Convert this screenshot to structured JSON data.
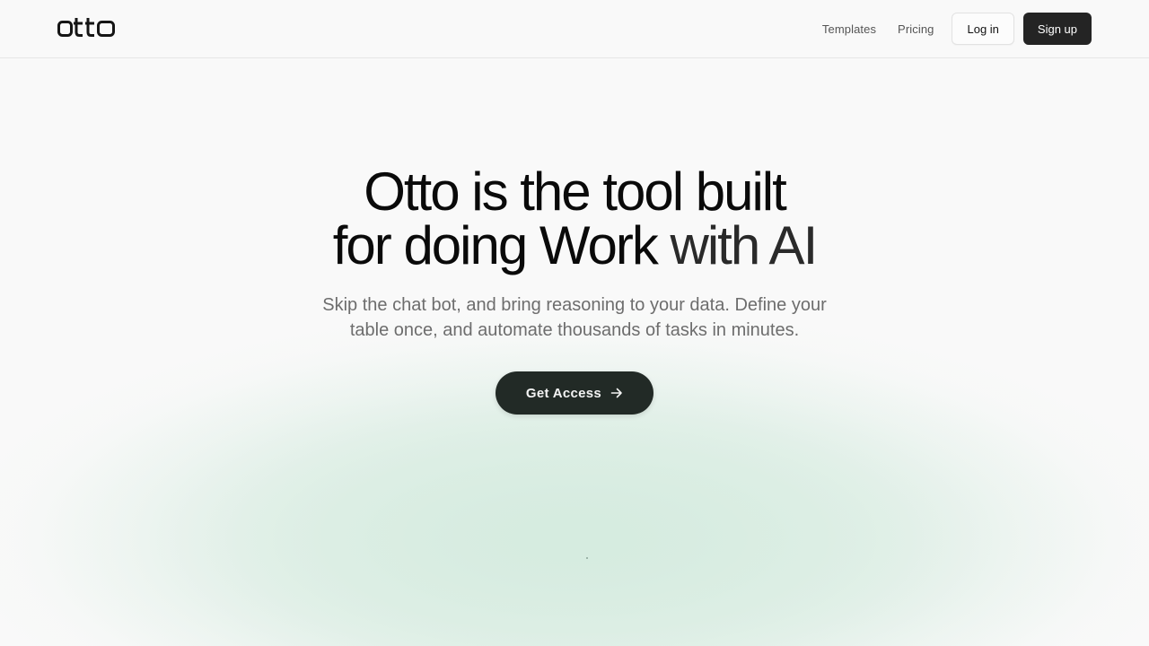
{
  "brand": {
    "logo_text": "otto",
    "logo_icon": "otto-wordmark"
  },
  "nav": {
    "templates_label": "Templates",
    "pricing_label": "Pricing",
    "login_label": "Log in",
    "signup_label": "Sign up"
  },
  "hero": {
    "title_line1": "Otto is the tool built",
    "title_line2_a": "for doing Work ",
    "title_line2_b": "with AI",
    "subtitle": "Skip the chat bot, and bring reasoning to your data. Define your table once, and automate thousands of tasks in minutes.",
    "cta_label": "Get Access",
    "cta_icon": "arrow-right-icon"
  },
  "colors": {
    "background": "#f9f9f9",
    "primary_dark": "#242424",
    "cta_bg": "#222a26",
    "glow": "#d6ece0",
    "muted_text": "#6d6d6d"
  }
}
